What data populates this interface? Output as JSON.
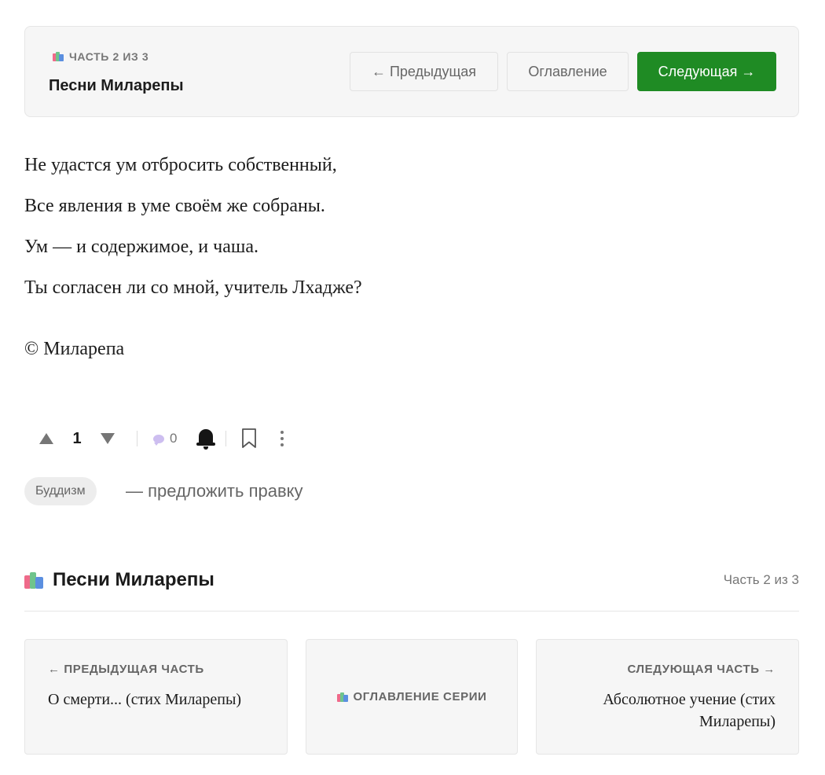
{
  "series_nav": {
    "kicker": "ЧАСТЬ 2 ИЗ 3",
    "title": "Песни Миларепы",
    "prev_label": "← Предыдущая",
    "toc_label": "Оглавление",
    "next_label": "Следующая →"
  },
  "poem": {
    "lines": [
      "Не удастся ум отбросить собственный,",
      "Все явления в уме своём же собраны.",
      "Ум — и содержимое, и чаша.",
      "Ты согласен ли со мной, учитель Лхадже?"
    ],
    "copyright": "© Миларепа"
  },
  "actions": {
    "score": "1",
    "comments": "0",
    "icons": [
      "arrow-up-icon",
      "arrow-down-icon",
      "comment-icon",
      "bell-icon",
      "bookmark-icon",
      "more-icon"
    ]
  },
  "tag": {
    "label": "Буддизм",
    "suggest_edit": "— предложить правку"
  },
  "series_footer": {
    "title": "Песни Миларепы",
    "part": "Часть 2 из 3",
    "prev_card": {
      "label": "← ПРЕДЫДУЩАЯ ЧАСТЬ",
      "title": "О смерти... (стих Миларепы)"
    },
    "toc_card": {
      "label": "ОГЛАВЛЕНИЕ СЕРИИ"
    },
    "next_card": {
      "label": "СЛЕДУЮЩАЯ ЧАСТЬ →",
      "title": "Абсолютное учение (стих Миларепы)"
    }
  },
  "colors": {
    "accent_green": "#1f8b24",
    "panel_bg": "#f6f6f6",
    "muted_text": "#666666"
  }
}
